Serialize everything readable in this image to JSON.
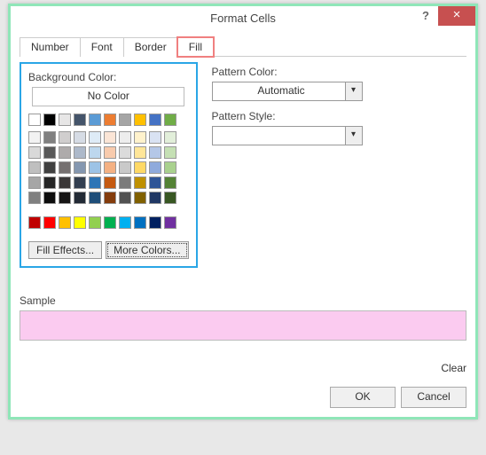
{
  "title": "Format Cells",
  "tabs": {
    "number": "Number",
    "font": "Font",
    "border": "Border",
    "fill": "Fill"
  },
  "labels": {
    "background_color": "Background Color:",
    "pattern_color": "Pattern Color:",
    "pattern_style": "Pattern Style:",
    "sample": "Sample"
  },
  "buttons": {
    "no_color": "No Color",
    "fill_effects": "Fill Effects...",
    "more_colors": "More Colors...",
    "clear": "Clear",
    "ok": "OK",
    "cancel": "Cancel"
  },
  "pattern_color": {
    "selected": "Automatic"
  },
  "pattern_style": {
    "selected": ""
  },
  "sample_color": "#fbcbf0",
  "palette_top": [
    [
      "#ffffff",
      "#000000",
      "#e7e6e6",
      "#44546a",
      "#5b9bd5",
      "#ed7d31",
      "#a5a5a5",
      "#ffc000",
      "#4472c4",
      "#70ad47"
    ]
  ],
  "palette_theme": [
    [
      "#f2f2f2",
      "#808080",
      "#d0cece",
      "#d6dce5",
      "#deebf7",
      "#fbe5d6",
      "#ededed",
      "#fff2cc",
      "#d9e2f3",
      "#e2efda"
    ],
    [
      "#d9d9d9",
      "#595959",
      "#aeabab",
      "#adb9ca",
      "#bdd7ee",
      "#f8cbad",
      "#dbdbdb",
      "#ffe699",
      "#b4c7e7",
      "#c5e0b4"
    ],
    [
      "#bfbfbf",
      "#404040",
      "#757070",
      "#8497b0",
      "#9dc3e6",
      "#f4b183",
      "#c9c9c9",
      "#ffd966",
      "#8faadc",
      "#a9d18e"
    ],
    [
      "#a6a6a6",
      "#262626",
      "#3b3838",
      "#333f50",
      "#2e75b6",
      "#c55a11",
      "#7b7b7b",
      "#bf9000",
      "#2f5597",
      "#548235"
    ],
    [
      "#808080",
      "#0d0d0d",
      "#171616",
      "#222a35",
      "#1f4e79",
      "#843c0c",
      "#525252",
      "#806000",
      "#203864",
      "#385723"
    ]
  ],
  "palette_standard": [
    [
      "#c00000",
      "#ff0000",
      "#ffc000",
      "#ffff00",
      "#92d050",
      "#00b050",
      "#00b0f0",
      "#0070c0",
      "#002060",
      "#7030a0"
    ]
  ]
}
